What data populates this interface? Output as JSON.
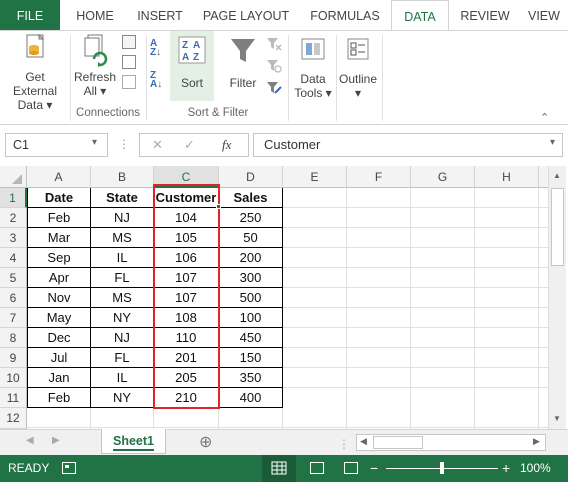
{
  "ribbon_tabs": [
    {
      "label": "FILE"
    },
    {
      "label": "HOME"
    },
    {
      "label": "INSERT"
    },
    {
      "label": "PAGE LAYOUT"
    },
    {
      "label": "FORMULAS"
    },
    {
      "label": "DATA"
    },
    {
      "label": "REVIEW"
    },
    {
      "label": "VIEW"
    }
  ],
  "ribbon": {
    "get_external_data": {
      "line1": "Get External",
      "line2": "Data ▾"
    },
    "refresh_all": {
      "line1": "Refresh",
      "line2": "All ▾"
    },
    "connections_label": "Connections",
    "sort": "Sort",
    "filter": "Filter",
    "sort_filter_label": "Sort & Filter",
    "data_tools": {
      "line1": "Data",
      "line2": "Tools ▾"
    },
    "outline": {
      "line1": "Outline",
      "line2": "▾"
    }
  },
  "formula_bar": {
    "name_box": "C1",
    "cancel_symbol": "✕",
    "enter_symbol": "✓",
    "fx_symbol": "fx",
    "value": "Customer"
  },
  "sheet": {
    "column_headers": [
      "A",
      "B",
      "C",
      "D",
      "E",
      "F",
      "G",
      "H"
    ],
    "row_headers": [
      "1",
      "2",
      "3",
      "4",
      "5",
      "6",
      "7",
      "8",
      "9",
      "10",
      "11",
      "12"
    ],
    "selected_column": "C",
    "selected_row": "1",
    "table_headers": [
      "Date",
      "State",
      "Customer",
      "Sales"
    ],
    "rows": [
      [
        "Feb",
        "NJ",
        "104",
        "250"
      ],
      [
        "Mar",
        "MS",
        "105",
        "50"
      ],
      [
        "Sep",
        "IL",
        "106",
        "200"
      ],
      [
        "Apr",
        "FL",
        "107",
        "300"
      ],
      [
        "Nov",
        "MS",
        "107",
        "500"
      ],
      [
        "May",
        "NY",
        "108",
        "100"
      ],
      [
        "Dec",
        "NJ",
        "110",
        "450"
      ],
      [
        "Jul",
        "FL",
        "201",
        "150"
      ],
      [
        "Jan",
        "IL",
        "205",
        "350"
      ],
      [
        "Feb",
        "NY",
        "210",
        "400"
      ]
    ],
    "highlight_color": "#e0242b"
  },
  "sheet_tabs": {
    "active": "Sheet1",
    "add_symbol": "⊕"
  },
  "status_bar": {
    "mode": "READY",
    "zoom": "100%",
    "zoom_minus": "−",
    "zoom_plus": "+"
  },
  "colors": {
    "excel_green": "#217346",
    "ribbon_highlight": "#e2f0e6"
  }
}
